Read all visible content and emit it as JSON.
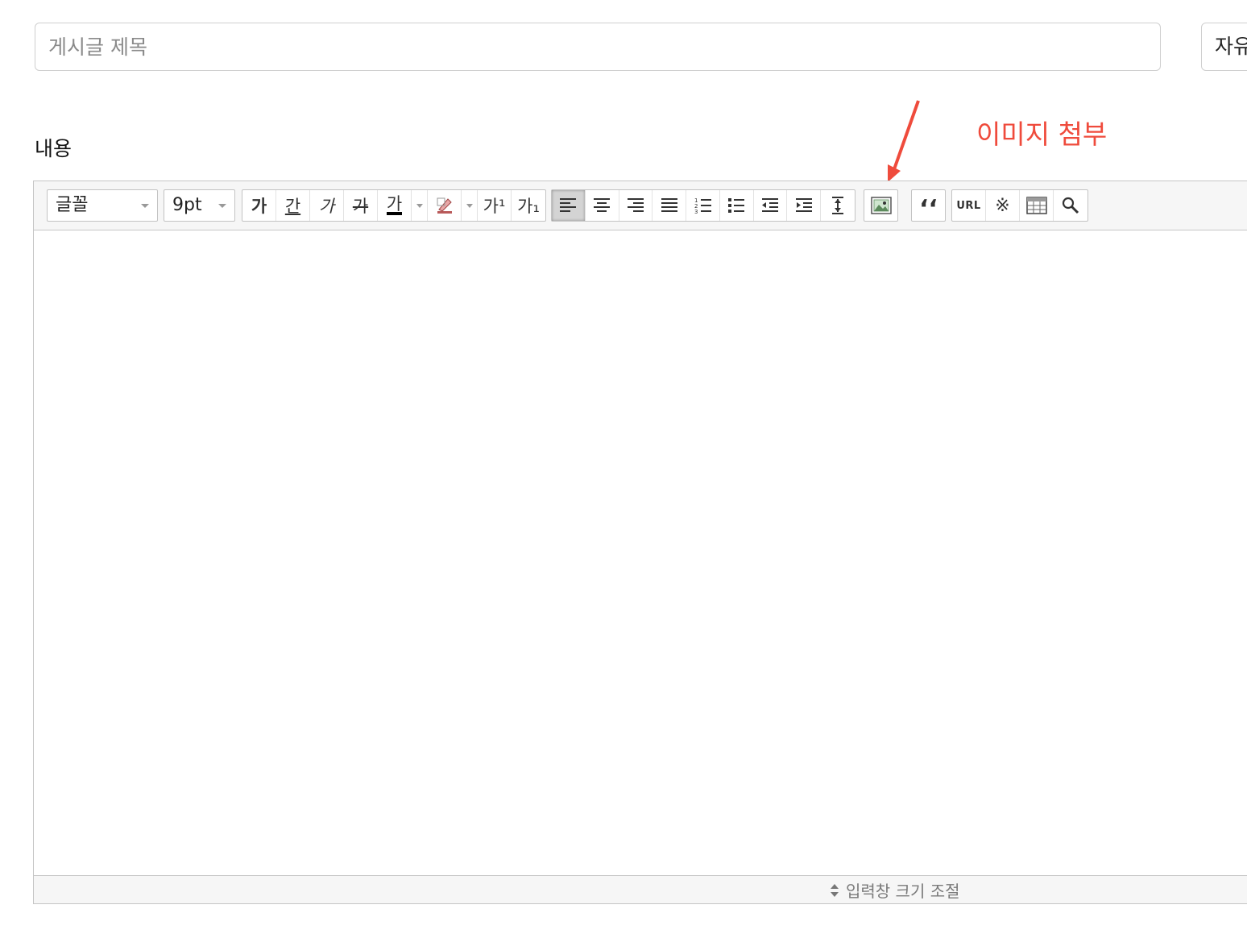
{
  "form": {
    "title_placeholder": "게시글 제목",
    "category_value": "자유",
    "content_label": "내용"
  },
  "annotation": {
    "text": "이미지 첨부",
    "color": "#ef4b3c"
  },
  "toolbar": {
    "font_dropdown": "글꼴",
    "size_dropdown": "9pt",
    "text_buttons": [
      {
        "name": "bold-button",
        "label": "가"
      },
      {
        "name": "underline-button",
        "label": "간"
      },
      {
        "name": "italic-button",
        "label": "가"
      },
      {
        "name": "strikethrough-button",
        "label": "가"
      },
      {
        "name": "font-color-button",
        "label": "가"
      },
      {
        "name": "highlight-button",
        "icon": "highlighter-icon"
      },
      {
        "name": "superscript-button",
        "label": "가¹"
      },
      {
        "name": "subscript-button",
        "label": "가₁"
      }
    ],
    "paragraph_buttons": [
      {
        "name": "align-left-button",
        "icon": "align-left-icon",
        "active": true
      },
      {
        "name": "align-center-button",
        "icon": "align-center-icon"
      },
      {
        "name": "align-right-button",
        "icon": "align-right-icon"
      },
      {
        "name": "align-justify-button",
        "icon": "align-justify-icon"
      },
      {
        "name": "ordered-list-button",
        "icon": "ordered-list-icon"
      },
      {
        "name": "unordered-list-button",
        "icon": "unordered-list-icon"
      },
      {
        "name": "outdent-button",
        "icon": "outdent-icon"
      },
      {
        "name": "indent-button",
        "icon": "indent-icon"
      },
      {
        "name": "line-height-button",
        "icon": "line-height-icon"
      }
    ],
    "image_button": {
      "icon": "image-icon"
    },
    "quote_button": {
      "label": "‘‘"
    },
    "insert_buttons": {
      "url_label": "URL",
      "special_char_label": "※",
      "table_icon": "table-icon",
      "find_icon": "search-icon"
    }
  },
  "resize": {
    "label": "입력창 크기 조절"
  }
}
